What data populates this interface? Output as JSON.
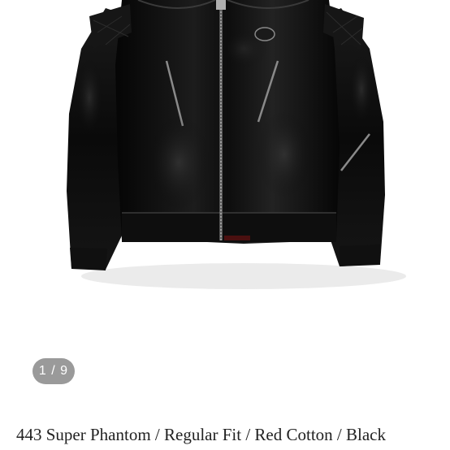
{
  "gallery": {
    "current_page": "1",
    "total_pages": "9",
    "indicator_text": "1 / 9",
    "image_subject": "black leather jacket"
  },
  "product": {
    "title": "443 Super Phantom / Regular Fit / Red Cotton / Black"
  },
  "colors": {
    "background": "#ffffff",
    "leather": "#0b0b0b",
    "indicator_bg": "#9a9a9a",
    "title_text": "#222222"
  }
}
